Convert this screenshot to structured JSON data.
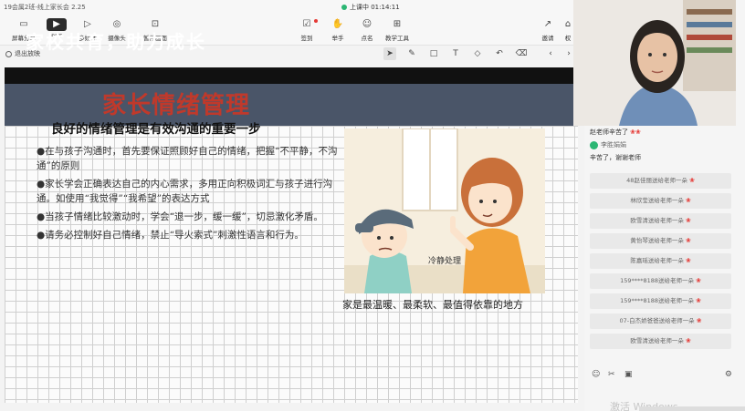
{
  "window": {
    "title": "19会属2班-线上家长会 2.25"
  },
  "live": {
    "status": "上课中 01:14:11"
  },
  "toolbar": {
    "left": [
      {
        "icon": "monitor-icon",
        "label": "屏幕分享"
      },
      {
        "icon": "ppt-icon",
        "label": "PPT"
      },
      {
        "icon": "media-icon",
        "label": "多媒体"
      },
      {
        "icon": "camera-icon",
        "label": "摄像头"
      },
      {
        "icon": "pause-screen-icon",
        "label": "暂停画面"
      }
    ],
    "middle": [
      {
        "icon": "checkin-icon",
        "label": "签到"
      },
      {
        "icon": "hand-icon",
        "label": "举手"
      },
      {
        "icon": "rollcall-icon",
        "label": "点名"
      },
      {
        "icon": "tools-icon",
        "label": "教学工具"
      }
    ],
    "right": [
      {
        "icon": "invite-icon",
        "label": "邀请"
      },
      {
        "icon": "more-icon",
        "label": "权"
      }
    ]
  },
  "subbar": {
    "exit_label": "退出放映"
  },
  "slide": {
    "banner_title": "家校共育，助力成长",
    "section_title": "家长情绪管理",
    "section_subtitle": "良好的情绪管理是有效沟通的重要一步",
    "bullets": [
      "●在与孩子沟通时，首先要保证照顾好自己的情绪，把握“不平静，不沟通”的原则",
      "●家长学会正确表达自己的内心需求，多用正向积极词汇与孩子进行沟通。如使用“我觉得”“我希望”的表达方式",
      "●当孩子情绪比较激动时，学会“退一步，缓一缓”，切忌激化矛盾。",
      "●请务必控制好自己情绪，禁止“导火索式”刺激性语言和行为。"
    ],
    "illustration_label": "冷静处理",
    "caption": "家是最温暖、最柔软、最值得依靠的地方"
  },
  "chat": {
    "top_msg": "赵老师辛苦了",
    "user_name": "李胜娟娟",
    "user_msg": "辛苦了，谢谢老师",
    "gifts": [
      "48赵佳丽送给老师一朵",
      "林欣莹送给老师一朵",
      "欧雪清送给老师一朵",
      "黄怡琴送给老师一朵",
      "陈嘉瑶送给老师一朵",
      "159****8188送给老师一朵",
      "159****8188送给老师一朵",
      "07-白杰娇爸爸送给老师一朵",
      "欧雪清送给老师一朵"
    ]
  },
  "watermark": "激活 Windows",
  "colors": {
    "banner": "#4a5568",
    "section_title": "#c0392b",
    "live_dot": "#2bb673"
  }
}
